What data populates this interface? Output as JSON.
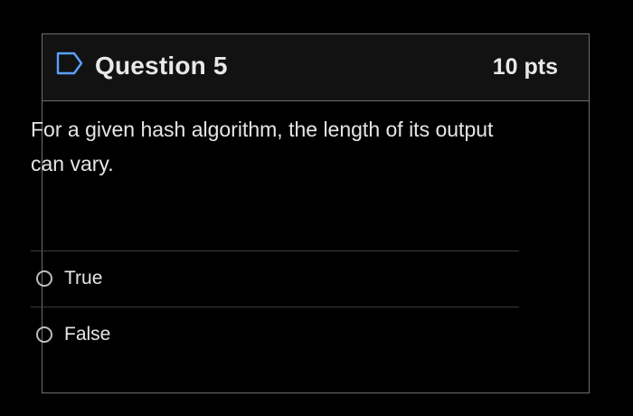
{
  "question": {
    "title": "Question 5",
    "points": "10 pts",
    "text": "For a given hash algorithm, the length of its output can vary.",
    "flag_icon": "flag-outline-icon"
  },
  "answers": [
    {
      "label": "True",
      "selected": false
    },
    {
      "label": "False",
      "selected": false
    }
  ],
  "colors": {
    "background": "#000000",
    "header_background": "#121212",
    "border": "#6e6e6e",
    "text": "#e6e6e6"
  }
}
